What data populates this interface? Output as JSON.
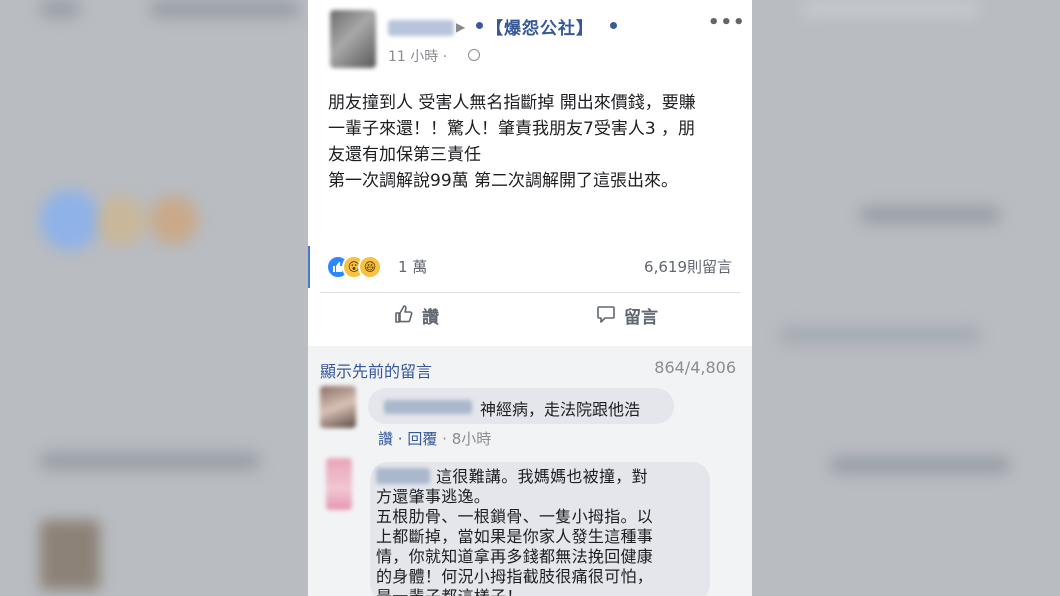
{
  "post": {
    "group_name": "【爆怨公社】",
    "time": "11 小時 ·",
    "text_lines": [
      "朋友撞到人 受害人無名指斷掉 開出來價錢，要賺",
      "一輩子來還！！驚人！肇責我朋友7受害人3 ，朋",
      "友還有加保第三責任",
      "第一次調解說99萬 第二次調解開了這張出來。"
    ],
    "reaction_count": "1 萬",
    "comment_count": "6,619則留言",
    "icons": {
      "more": "more-dots-icon",
      "privacy": "globe-icon",
      "reactions": [
        "like-reaction-icon",
        "wow-reaction-icon",
        "haha-reaction-icon"
      ]
    }
  },
  "actions": {
    "like_label": "讚",
    "comment_label": "留言"
  },
  "comments_section": {
    "prev_label": "顯示先前的留言",
    "prev_count": "864/4,806",
    "comments": [
      {
        "text": "神經病，走法院跟他浩",
        "like_label": "讚",
        "reply_label": "回覆",
        "time": "8小時"
      },
      {
        "text_lines": [
          "這很難講。我媽媽也被撞，對",
          "方還肇事逃逸。",
          "五根肋骨、一根鎖骨、一隻小拇指。以",
          "上都斷掉，當如果是你家人發生這種事",
          "情，你就知道拿再多錢都無法挽回健康",
          "的身體！何況小拇指截肢很痛很可怕，",
          "是一輩子都這樣子！"
        ]
      }
    ]
  },
  "colors": {
    "link": "#365899",
    "accent": "#4a76c9",
    "bubble": "#e4e6eb"
  }
}
